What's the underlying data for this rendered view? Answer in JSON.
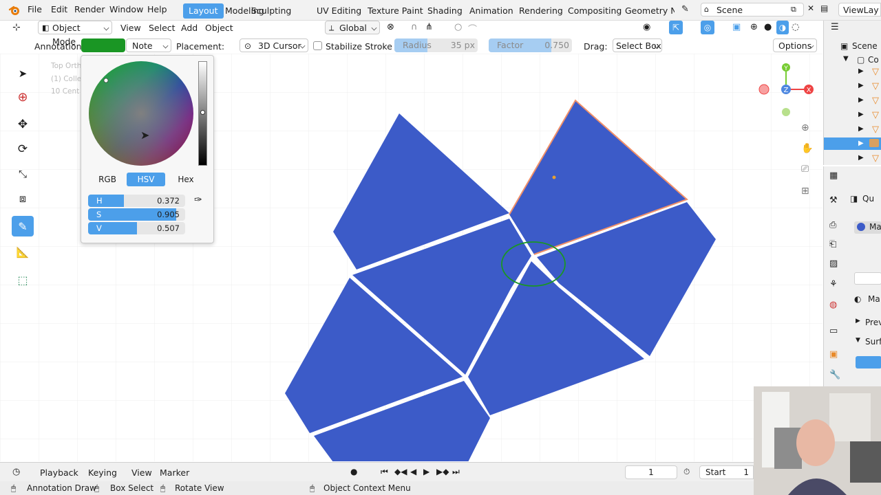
{
  "topbar": {
    "menus": [
      "File",
      "Edit",
      "Render",
      "Window",
      "Help"
    ],
    "workspaces": [
      "Layout",
      "Modeling",
      "Sculpting",
      "UV Editing",
      "Texture Paint",
      "Shading",
      "Animation",
      "Rendering",
      "Compositing",
      "Geometry No"
    ],
    "active_workspace": "Layout",
    "scene": "Scene",
    "view_layer": "ViewLay"
  },
  "header": {
    "mode": "Object Mode",
    "menus": [
      "View",
      "Select",
      "Add",
      "Object"
    ],
    "transform_orientation": "Global"
  },
  "tool_settings": {
    "annotation_label": "Annotation:",
    "annotation_color": "#1a9624",
    "layer": "Note",
    "placement_label": "Placement:",
    "placement": "3D Cursor",
    "stabilize_label": "Stabilize Stroke",
    "radius_label": "Radius",
    "radius_value": "35 px",
    "factor_label": "Factor",
    "factor_value": "0.750",
    "drag_label": "Drag:",
    "drag_value": "Select Box",
    "options_label": "Options"
  },
  "color_picker": {
    "tabs": [
      "RGB",
      "HSV",
      "Hex"
    ],
    "active_tab": "HSV",
    "h_label": "H",
    "h_value": "0.372",
    "h_fraction": 0.372,
    "s_label": "S",
    "s_value": "0.905",
    "s_fraction": 0.905,
    "v_label": "V",
    "v_value": "0.507",
    "v_fraction": 0.507
  },
  "viewport": {
    "overlay_lines": [
      "Top Orth",
      "(1) Colle",
      "10 Cent"
    ],
    "mesh_color": "#3c5bc8",
    "selection_color": "#f0906a"
  },
  "outliner": {
    "items": [
      "Scene",
      "Co"
    ]
  },
  "properties": {
    "labels": [
      "Qu",
      "Ma",
      "Ma",
      "Prev",
      "Surf"
    ]
  },
  "timeline": {
    "menus": [
      "Playback",
      "Keying",
      "View",
      "Marker"
    ],
    "current_frame": "1",
    "start_label": "Start",
    "start_value": "1"
  },
  "statusbar": {
    "items": [
      "Annotation Draw",
      "Box Select",
      "Rotate View",
      "Object Context Menu"
    ]
  },
  "colors": {
    "accent": "#4c9fea",
    "annotation_green": "#1a9624"
  }
}
